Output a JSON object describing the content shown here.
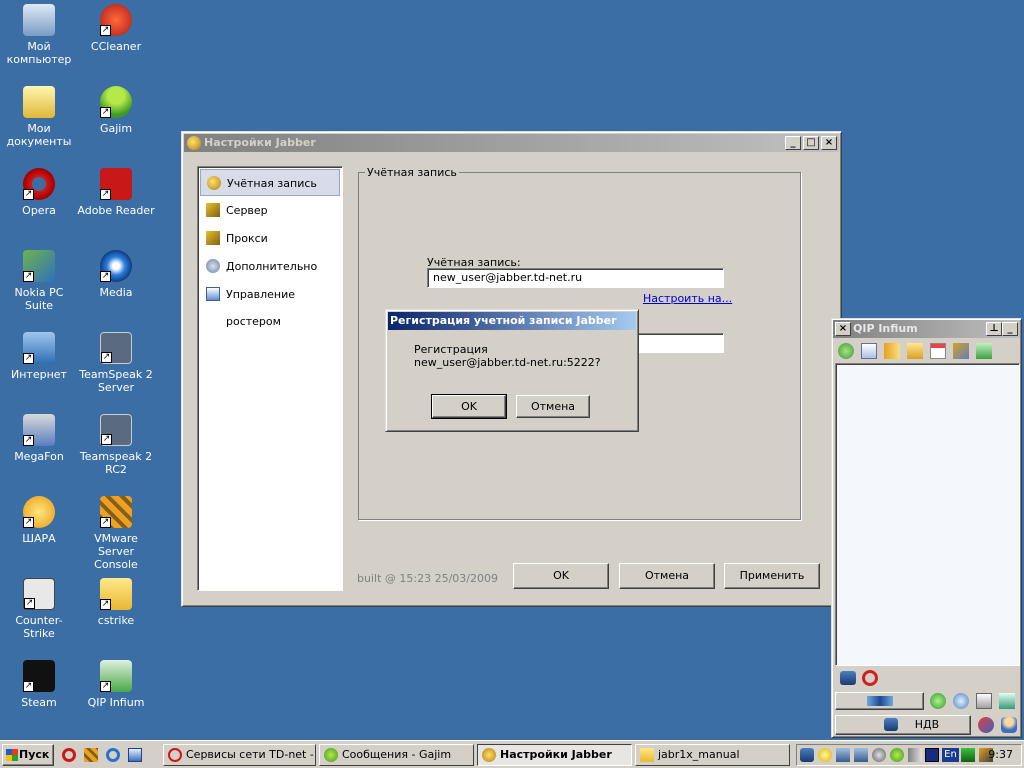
{
  "desktop": {
    "icons": [
      {
        "label": "Мой компьютер",
        "icon": "my-computer-icon"
      },
      {
        "label": "CCleaner",
        "icon": "ccleaner-icon"
      },
      {
        "label": "Мои документы",
        "icon": "my-documents-icon"
      },
      {
        "label": "Gajim",
        "icon": "gajim-icon"
      },
      {
        "label": "Opera",
        "icon": "opera-icon"
      },
      {
        "label": "Adobe Reader",
        "icon": "adobe-reader-icon"
      },
      {
        "label": "Nokia PC Suite",
        "icon": "nokia-pc-suite-icon"
      },
      {
        "label": "Media",
        "icon": "media-player-icon"
      },
      {
        "label": "Интернет",
        "icon": "internet-icon"
      },
      {
        "label": "TeamSpeak 2 Server",
        "icon": "teamspeak-server-icon"
      },
      {
        "label": "MegaFon",
        "icon": "megafon-icon"
      },
      {
        "label": "Teamspeak 2 RC2",
        "icon": "teamspeak-rc2-icon"
      },
      {
        "label": "ШАРА",
        "icon": "shara-icon"
      },
      {
        "label": "VMware Server Console",
        "icon": "vmware-icon"
      },
      {
        "label": "Counter-Strike",
        "icon": "counter-strike-icon"
      },
      {
        "label": "cstrike",
        "icon": "folder-icon"
      },
      {
        "label": "Steam",
        "icon": "steam-icon"
      },
      {
        "label": "QIP Infium",
        "icon": "qip-infium-icon"
      }
    ]
  },
  "jabber_window": {
    "title": "Настройки Jabber",
    "nav": [
      {
        "label": "Учётная запись"
      },
      {
        "label": "Сервер"
      },
      {
        "label": "Прокси"
      },
      {
        "label": "Дополнительно"
      },
      {
        "label": "Управление ростером"
      }
    ],
    "group_title": "Учётная запись",
    "account_label": "Учётная запись:",
    "account_value": "new_user@jabber.td-net.ru",
    "configure_link": "Настроить на...",
    "build_info": "built @ 15:23 25/03/2009",
    "ok": "OK",
    "cancel": "Отмена",
    "apply": "Применить"
  },
  "dialog": {
    "title": "Регистрация учетной записи Jabber",
    "line1": "Регистрация",
    "line2": "new_user@jabber.td-net.ru:5222?",
    "ok": "OK",
    "cancel": "Отмена"
  },
  "qip": {
    "title": "QIP Infium",
    "status": "НДВ"
  },
  "taskbar": {
    "start": "Пуск",
    "tasks": [
      {
        "label": "Сервисы сети TD-net -..."
      },
      {
        "label": "Сообщения - Gajim"
      },
      {
        "label": "Настройки Jabber"
      },
      {
        "label": "jabr1x_manual"
      }
    ],
    "lang": "En",
    "clock": "9:37"
  },
  "colors": {
    "desktop": "#3a6ea5",
    "active_title": "#0a246a",
    "window_face": "#d4d0c8"
  }
}
